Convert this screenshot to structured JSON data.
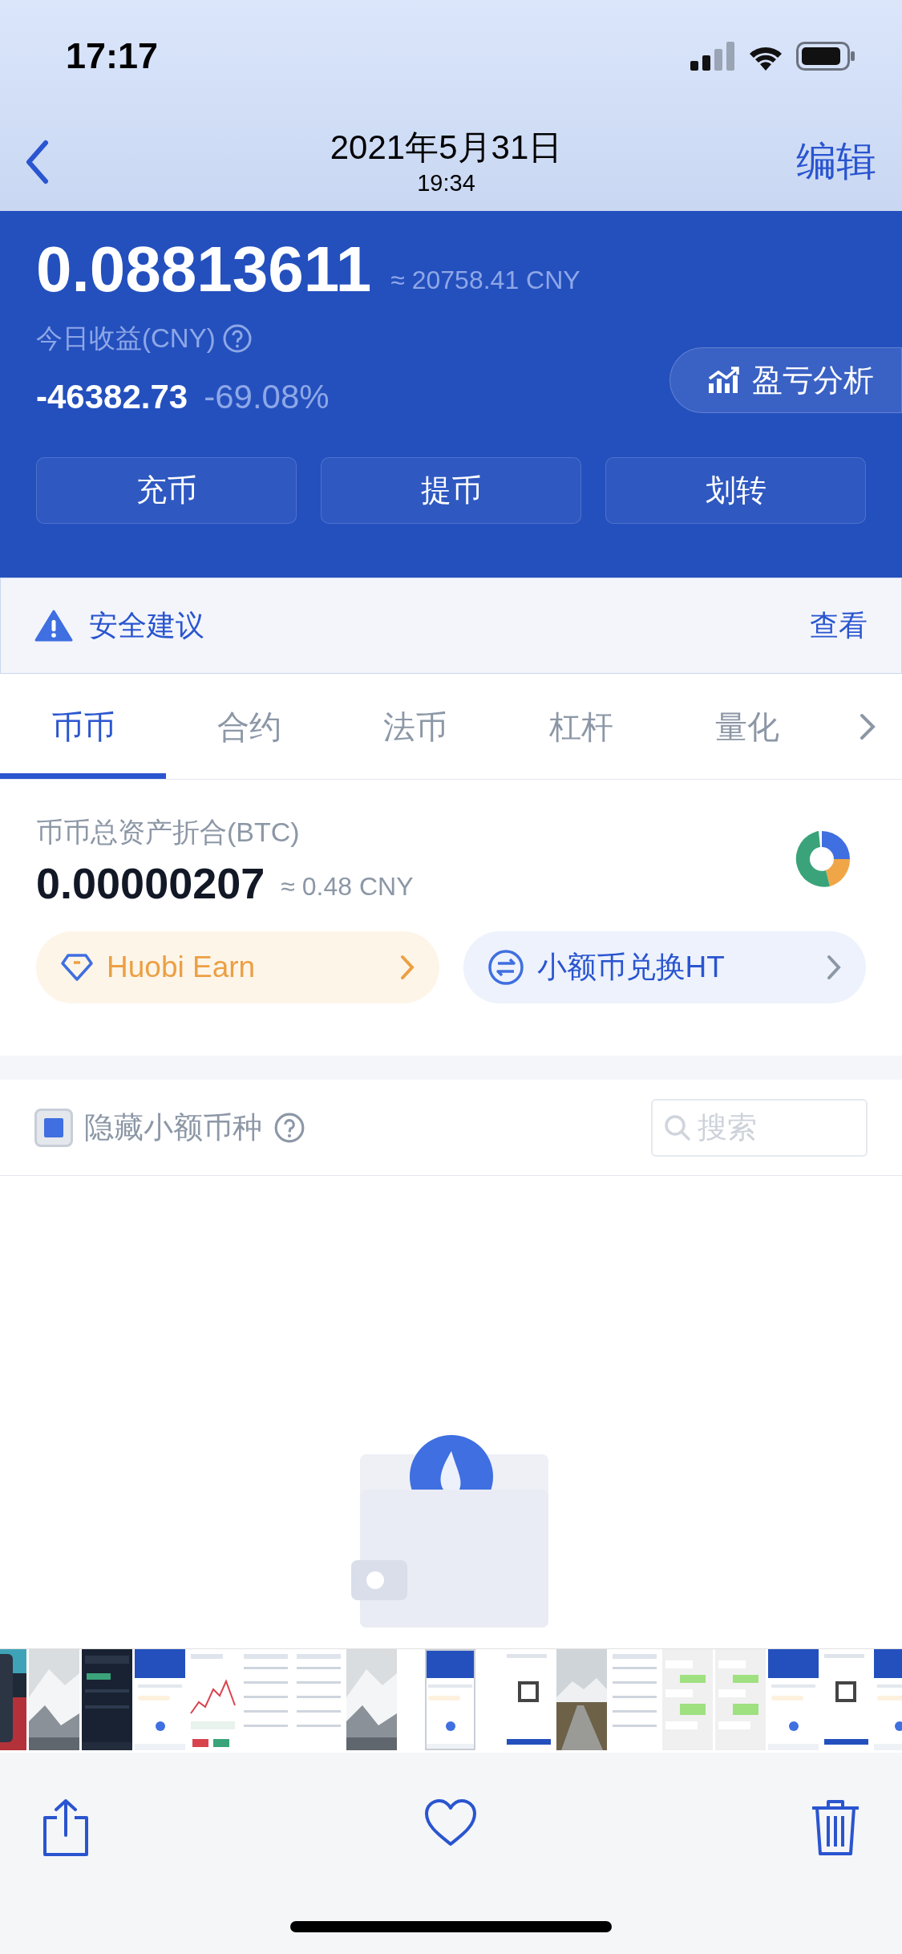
{
  "status_bar": {
    "time": "17:17"
  },
  "nav": {
    "title": "2021年5月31日",
    "subtitle": "19:34",
    "action": "编辑"
  },
  "overview": {
    "btc_value": "0.08813611",
    "cny_approx": "≈ 20758.41 CNY",
    "today_label": "今日收益(CNY)",
    "today_pnl": "-46382.73",
    "today_pct": "-69.08%",
    "analysis_button": "盈亏分析"
  },
  "actions": [
    "充币",
    "提币",
    "划转"
  ],
  "notice": {
    "text": "安全建议",
    "link": "查看"
  },
  "tabs": [
    {
      "label": "币币",
      "selected": true
    },
    {
      "label": "合约",
      "selected": false
    },
    {
      "label": "法币",
      "selected": false
    },
    {
      "label": "杠杆",
      "selected": false
    },
    {
      "label": "量化",
      "selected": false
    }
  ],
  "spot": {
    "label": "币币总资产折合(BTC)",
    "value": "0.00000207",
    "cny_approx": "≈ 0.48 CNY"
  },
  "promos": [
    {
      "kind": "earn",
      "label": "Huobi Earn"
    },
    {
      "kind": "exchange",
      "label": "小额币兑换HT"
    }
  ],
  "filter": {
    "label": "隐藏小额币种",
    "checked": true,
    "search_placeholder": "搜索"
  },
  "thumbnails": [
    {
      "kind": "red",
      "selected": false
    },
    {
      "kind": "snow",
      "selected": false
    },
    {
      "kind": "dark",
      "selected": false
    },
    {
      "kind": "blue",
      "selected": false
    },
    {
      "kind": "chart",
      "selected": false
    },
    {
      "kind": "list",
      "selected": false
    },
    {
      "kind": "list",
      "selected": false
    },
    {
      "kind": "snow",
      "selected": false
    },
    {
      "kind": "blue",
      "selected": true
    },
    {
      "kind": "white",
      "selected": false
    },
    {
      "kind": "road",
      "selected": false
    },
    {
      "kind": "list",
      "selected": false
    },
    {
      "kind": "chat",
      "selected": false
    },
    {
      "kind": "chat",
      "selected": false
    },
    {
      "kind": "blue",
      "selected": false
    },
    {
      "kind": "white",
      "selected": false
    },
    {
      "kind": "blue",
      "selected": false
    }
  ]
}
